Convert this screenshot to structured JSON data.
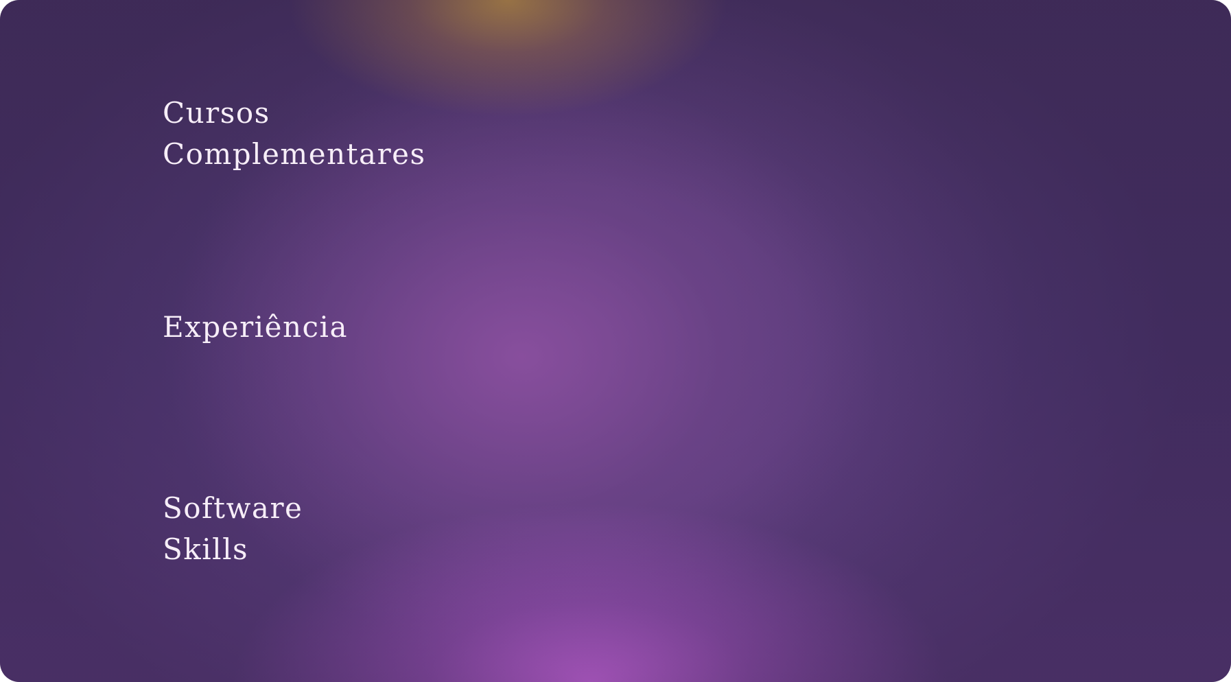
{
  "sections": {
    "cursos": {
      "line1": "Cursos",
      "line2": "Complementares"
    },
    "experiencia": {
      "line1": "Experiência"
    },
    "software": {
      "line1": "Software",
      "line2": "Skills"
    }
  },
  "colors": {
    "text": "#f7eef8",
    "background_base": "#4e3670",
    "glow_top": "#c49646",
    "glow_bottom": "#c864dc"
  }
}
